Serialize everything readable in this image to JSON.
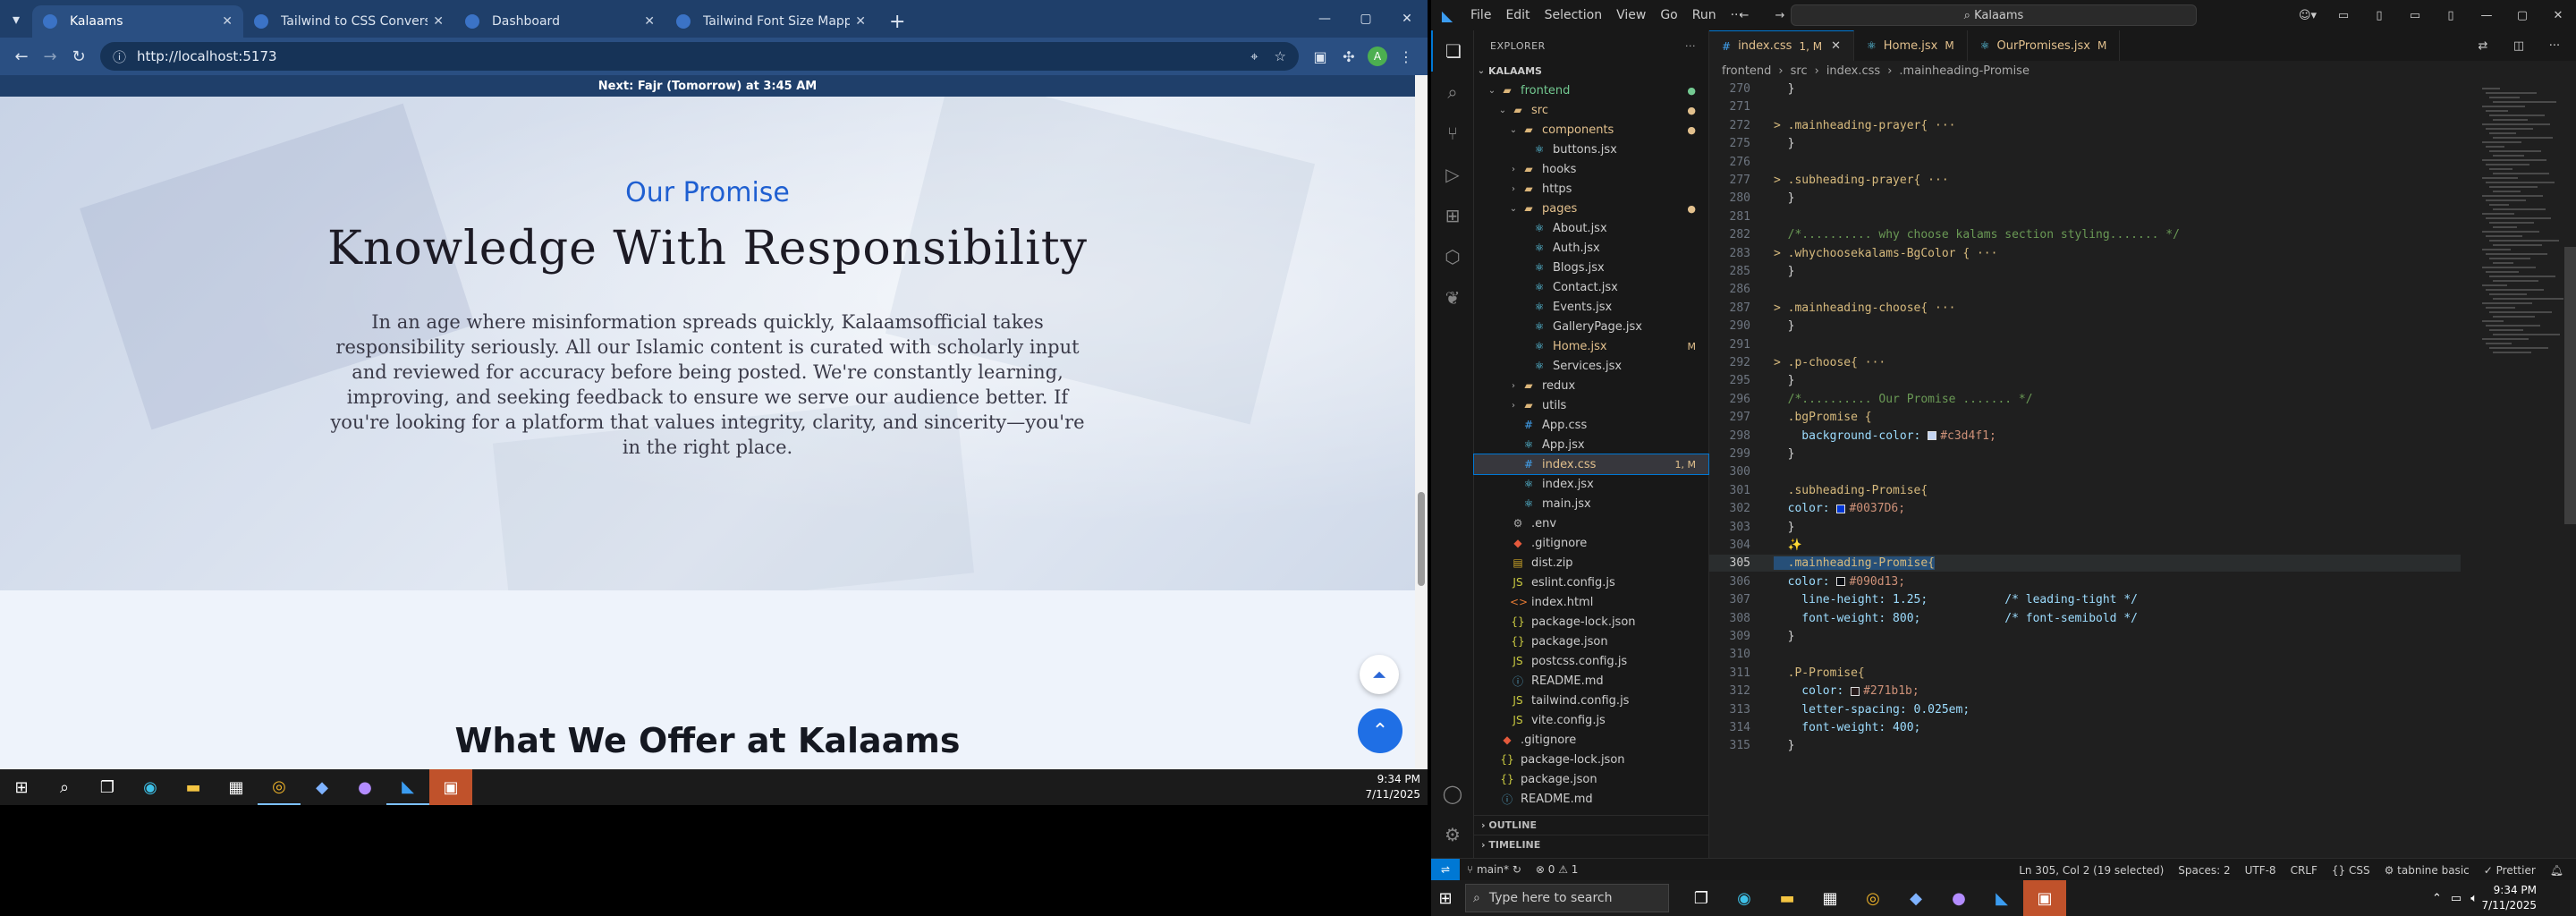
{
  "chrome": {
    "tabs": [
      {
        "title": "Kalaams",
        "active": true
      },
      {
        "title": "Tailwind to CSS Conversion",
        "active": false
      },
      {
        "title": "Dashboard",
        "active": false
      },
      {
        "title": "Tailwind Font Size Mapping",
        "active": false
      }
    ],
    "url": "http://localhost:5173",
    "profile_initial": "A"
  },
  "page": {
    "notice_prefix": "Next:",
    "notice_bold": "Fajr (Tomorrow)",
    "notice_suffix": "at 3:45 AM",
    "eyebrow": "Our Promise",
    "heading": "Knowledge With Responsibility",
    "paragraph": "In an age where misinformation spreads quickly, Kalaamsofficial takes responsibility seriously. All our Islamic content is curated with scholarly input and reviewed for accuracy before being posted. We're constantly learning, improving, and seeking feedback to ensure we serve our audience better. If you're looking for a platform that values integrity, clarity, and sincerity—you're in the right place.",
    "next_section": "What We Offer at Kalaams",
    "accent_color": "#1f5fd1",
    "fab_color": "#1f6fe5"
  },
  "left_taskbar": {
    "time": "9:34 PM",
    "date": "7/11/2025"
  },
  "vscode": {
    "menu": [
      "File",
      "Edit",
      "Selection",
      "View",
      "Go",
      "Run",
      "···"
    ],
    "search": "Kalaams",
    "explorer_title": "EXPLORER",
    "workspace": "KALAAMS",
    "tree": [
      {
        "label": "frontend",
        "indent": 1,
        "kind": "folder-open",
        "status": "●",
        "status_color": "#73c991"
      },
      {
        "label": "src",
        "indent": 2,
        "kind": "folder-open",
        "status": "●",
        "status_color": "#e2c08d"
      },
      {
        "label": "components",
        "indent": 3,
        "kind": "folder-open",
        "status": "●",
        "status_color": "#e2c08d"
      },
      {
        "label": "buttons.jsx",
        "indent": 4,
        "kind": "jsx",
        "status": "",
        "status_color": ""
      },
      {
        "label": "hooks",
        "indent": 3,
        "kind": "folder",
        "status": "",
        "status_color": ""
      },
      {
        "label": "https",
        "indent": 3,
        "kind": "folder",
        "status": "",
        "status_color": ""
      },
      {
        "label": "pages",
        "indent": 3,
        "kind": "folder-open",
        "status": "●",
        "status_color": "#e2c08d"
      },
      {
        "label": "About.jsx",
        "indent": 4,
        "kind": "jsx",
        "status": "",
        "status_color": ""
      },
      {
        "label": "Auth.jsx",
        "indent": 4,
        "kind": "jsx",
        "status": "",
        "status_color": ""
      },
      {
        "label": "Blogs.jsx",
        "indent": 4,
        "kind": "jsx",
        "status": "",
        "status_color": ""
      },
      {
        "label": "Contact.jsx",
        "indent": 4,
        "kind": "jsx",
        "status": "",
        "status_color": ""
      },
      {
        "label": "Events.jsx",
        "indent": 4,
        "kind": "jsx",
        "status": "",
        "status_color": ""
      },
      {
        "label": "GalleryPage.jsx",
        "indent": 4,
        "kind": "jsx",
        "status": "",
        "status_color": ""
      },
      {
        "label": "Home.jsx",
        "indent": 4,
        "kind": "jsx",
        "status": "M",
        "status_color": "#e2c08d"
      },
      {
        "label": "Services.jsx",
        "indent": 4,
        "kind": "jsx",
        "status": "",
        "status_color": ""
      },
      {
        "label": "redux",
        "indent": 3,
        "kind": "folder",
        "status": "",
        "status_color": ""
      },
      {
        "label": "utils",
        "indent": 3,
        "kind": "folder",
        "status": "",
        "status_color": ""
      },
      {
        "label": "App.css",
        "indent": 3,
        "kind": "css",
        "status": "",
        "status_color": ""
      },
      {
        "label": "App.jsx",
        "indent": 3,
        "kind": "jsx",
        "status": "",
        "status_color": ""
      },
      {
        "label": "index.css",
        "indent": 3,
        "kind": "css",
        "status": "1, M",
        "status_color": "#e2c08d",
        "selected": true
      },
      {
        "label": "index.jsx",
        "indent": 3,
        "kind": "jsx",
        "status": "",
        "status_color": ""
      },
      {
        "label": "main.jsx",
        "indent": 3,
        "kind": "jsx",
        "status": "",
        "status_color": ""
      },
      {
        "label": ".env",
        "indent": 2,
        "kind": "env",
        "status": "",
        "status_color": ""
      },
      {
        "label": ".gitignore",
        "indent": 2,
        "kind": "git",
        "status": "",
        "status_color": ""
      },
      {
        "label": "dist.zip",
        "indent": 2,
        "kind": "zip",
        "status": "",
        "status_color": ""
      },
      {
        "label": "eslint.config.js",
        "indent": 2,
        "kind": "js",
        "status": "",
        "status_color": ""
      },
      {
        "label": "index.html",
        "indent": 2,
        "kind": "html",
        "status": "",
        "status_color": ""
      },
      {
        "label": "package-lock.json",
        "indent": 2,
        "kind": "json",
        "status": "",
        "status_color": ""
      },
      {
        "label": "package.json",
        "indent": 2,
        "kind": "json",
        "status": "",
        "status_color": ""
      },
      {
        "label": "postcss.config.js",
        "indent": 2,
        "kind": "js",
        "status": "",
        "status_color": ""
      },
      {
        "label": "README.md",
        "indent": 2,
        "kind": "md",
        "status": "",
        "status_color": ""
      },
      {
        "label": "tailwind.config.js",
        "indent": 2,
        "kind": "js",
        "status": "",
        "status_color": ""
      },
      {
        "label": "vite.config.js",
        "indent": 2,
        "kind": "js",
        "status": "",
        "status_color": ""
      },
      {
        "label": ".gitignore",
        "indent": 1,
        "kind": "git",
        "status": "",
        "status_color": ""
      },
      {
        "label": "package-lock.json",
        "indent": 1,
        "kind": "json",
        "status": "",
        "status_color": ""
      },
      {
        "label": "package.json",
        "indent": 1,
        "kind": "json",
        "status": "",
        "status_color": ""
      },
      {
        "label": "README.md",
        "indent": 1,
        "kind": "md",
        "status": "",
        "status_color": ""
      }
    ],
    "outline_label": "OUTLINE",
    "timeline_label": "TIMELINE",
    "editor_tabs": [
      {
        "label": "index.css",
        "status": "1, M",
        "active": true
      },
      {
        "label": "Home.jsx",
        "status": "M",
        "active": false
      },
      {
        "label": "OurPromises.jsx",
        "status": "M",
        "active": false
      }
    ],
    "breadcrumbs": [
      "frontend",
      "src",
      "index.css",
      ".mainheading-Promise"
    ],
    "code": [
      {
        "n": 270,
        "t": "  }"
      },
      {
        "n": 271,
        "t": ""
      },
      {
        "n": 272,
        "t": "> .mainheading-prayer{ ···",
        "k": "sel"
      },
      {
        "n": 275,
        "t": "  }"
      },
      {
        "n": 276,
        "t": ""
      },
      {
        "n": 277,
        "t": "> .subheading-prayer{ ···",
        "k": "sel"
      },
      {
        "n": 280,
        "t": "  }"
      },
      {
        "n": 281,
        "t": ""
      },
      {
        "n": 282,
        "t": "  /*.......... why choose kalams section styling....... */",
        "k": "cmt"
      },
      {
        "n": 283,
        "t": "> .whychoosekalams-BgColor { ···",
        "k": "sel"
      },
      {
        "n": 285,
        "t": "  }"
      },
      {
        "n": 286,
        "t": ""
      },
      {
        "n": 287,
        "t": "> .mainheading-choose{ ···",
        "k": "sel"
      },
      {
        "n": 290,
        "t": "  }"
      },
      {
        "n": 291,
        "t": ""
      },
      {
        "n": 292,
        "t": "> .p-choose{ ···",
        "k": "sel"
      },
      {
        "n": 295,
        "t": "  }"
      },
      {
        "n": 296,
        "t": "  /*.......... Our Promise ....... */",
        "k": "cmt"
      },
      {
        "n": 297,
        "t": "  .bgPromise {",
        "k": "sel"
      },
      {
        "n": 298,
        "t": "    background-color: ",
        "k": "prop",
        "v": "#c3d4f1;",
        "sw": "#c3d4f1"
      },
      {
        "n": 299,
        "t": "  }"
      },
      {
        "n": 300,
        "t": ""
      },
      {
        "n": 301,
        "t": "  .subheading-Promise{",
        "k": "sel"
      },
      {
        "n": 302,
        "t": "  color: ",
        "k": "prop",
        "v": "#0037D6;",
        "sw": "#0037D6"
      },
      {
        "n": 303,
        "t": "  }"
      },
      {
        "n": 304,
        "t": "  ✨",
        "k": "spark"
      },
      {
        "n": 305,
        "t": "  .mainheading-Promise{",
        "k": "sel",
        "current": true
      },
      {
        "n": 306,
        "t": "  color: ",
        "k": "prop",
        "v": "#090d13;",
        "sw": "#090d13"
      },
      {
        "n": 307,
        "t": "    line-height: 1.25;           /* leading-tight */",
        "k": "prop2"
      },
      {
        "n": 308,
        "t": "    font-weight: 800;            /* font-semibold */",
        "k": "prop2"
      },
      {
        "n": 309,
        "t": "  }"
      },
      {
        "n": 310,
        "t": ""
      },
      {
        "n": 311,
        "t": "  .P-Promise{",
        "k": "sel"
      },
      {
        "n": 312,
        "t": "    color: ",
        "k": "prop",
        "v": "#271b1b;",
        "sw": "#271b1b"
      },
      {
        "n": 313,
        "t": "    letter-spacing: 0.025em;",
        "k": "prop2"
      },
      {
        "n": 314,
        "t": "    font-weight: 400;",
        "k": "prop2"
      },
      {
        "n": 315,
        "t": "  }"
      }
    ],
    "status": {
      "branch": "main*",
      "problems": "⊗ 0 ⚠ 1",
      "cursor": "Ln 305, Col 2 (19 selected)",
      "spaces": "Spaces: 2",
      "encoding": "UTF-8",
      "eol": "CRLF",
      "language": "CSS",
      "tabnine": "tabnine basic",
      "prettier": "Prettier"
    }
  },
  "right_taskbar": {
    "search_placeholder": "Type here to search",
    "time": "9:34 PM",
    "date": "7/11/2025"
  }
}
